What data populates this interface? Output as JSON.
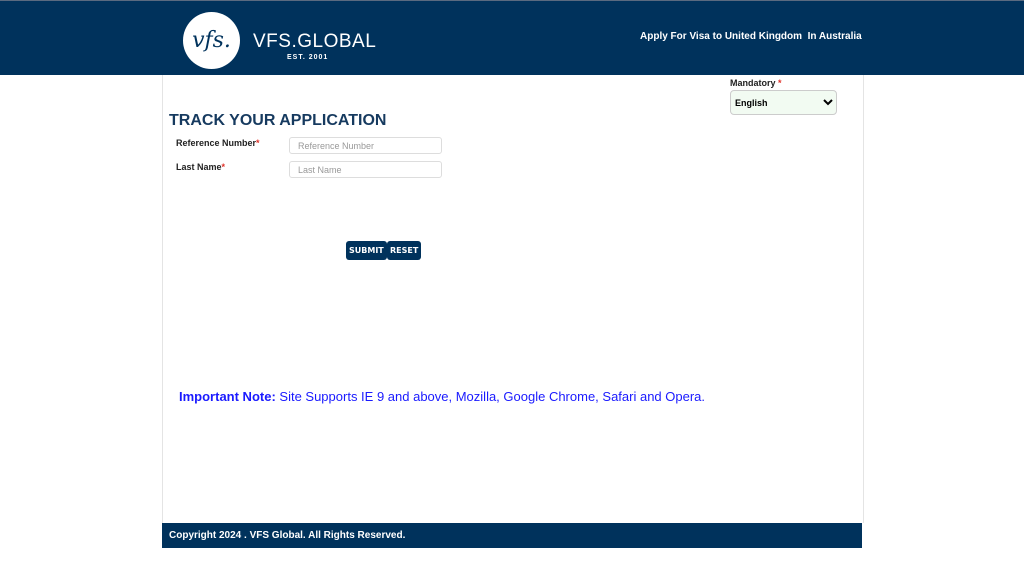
{
  "header": {
    "logo_text": "vfs.",
    "brand": "VFS.GLOBAL",
    "est": "EST. 2001",
    "title": "Apply For Visa to United Kingdom  In Australia"
  },
  "language": {
    "label": "Mandatory",
    "required_mark": "*",
    "selected": "English"
  },
  "form": {
    "title": "TRACK YOUR APPLICATION",
    "reference": {
      "label": "Reference Number",
      "required_mark": "*",
      "placeholder": "Reference Number",
      "value": ""
    },
    "last_name": {
      "label": "Last Name",
      "required_mark": "*",
      "placeholder": "Last Name",
      "value": ""
    },
    "submit": "SUBMIT",
    "reset": "RESET"
  },
  "note": {
    "label": "Important Note:",
    "text": " Site Supports IE 9 and above, Mozilla, Google Chrome, Safari and Opera."
  },
  "footer": {
    "copyright": "Copyright 2024 . VFS Global. All Rights Reserved."
  },
  "colors": {
    "brand": "#00325c",
    "note": "#1a1aff",
    "required": "#e0322a"
  }
}
